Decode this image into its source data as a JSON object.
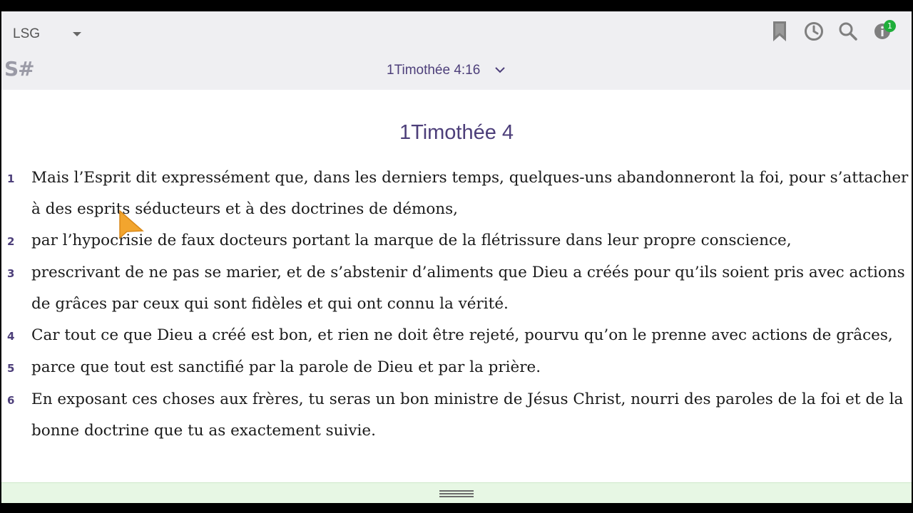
{
  "toolbar": {
    "version": "LSG",
    "logo": "S#",
    "reference": "1Timothée 4:16",
    "notification_count": "1"
  },
  "chapter": {
    "title": "1Timothée 4",
    "verses": [
      {
        "num": "1",
        "text": "Mais l’Esprit dit expressément que, dans les derniers temps, quelques-uns abandonneront la foi, pour s’attacher à des esprits séducteurs et à des doctrines de démons,"
      },
      {
        "num": "2",
        "text": "par l’hypocrisie de faux docteurs portant la marque de la flétrissure dans leur propre conscience,"
      },
      {
        "num": "3",
        "text": "prescrivant de ne pas se marier, et de s’abstenir d’aliments que Dieu a créés pour qu’ils soient pris avec actions de grâces par ceux qui sont fidèles et qui ont connu la vérité."
      },
      {
        "num": "4",
        "text": "Car tout ce que Dieu a créé est bon, et rien ne doit être rejeté, pourvu qu’on le prenne avec actions de grâces,"
      },
      {
        "num": "5",
        "text": "parce que tout est sanctifié par la parole de Dieu et par la prière."
      },
      {
        "num": "6",
        "text": "En exposant ces choses aux frères, tu seras un bon ministre de Jésus Christ, nourri des paroles de la foi et de la bonne doctrine que tu as exactement suivie."
      }
    ]
  },
  "colors": {
    "accent": "#4d3f7a",
    "toolbar_bg": "#efeff2",
    "bottom_bar_bg": "#e7f7e4",
    "badge": "#1fae3a"
  },
  "icons": [
    "bookmark-icon",
    "history-clock-icon",
    "search-icon",
    "info-icon",
    "dropdown-caret-icon",
    "chevron-down-icon",
    "drag-handle-icon"
  ]
}
